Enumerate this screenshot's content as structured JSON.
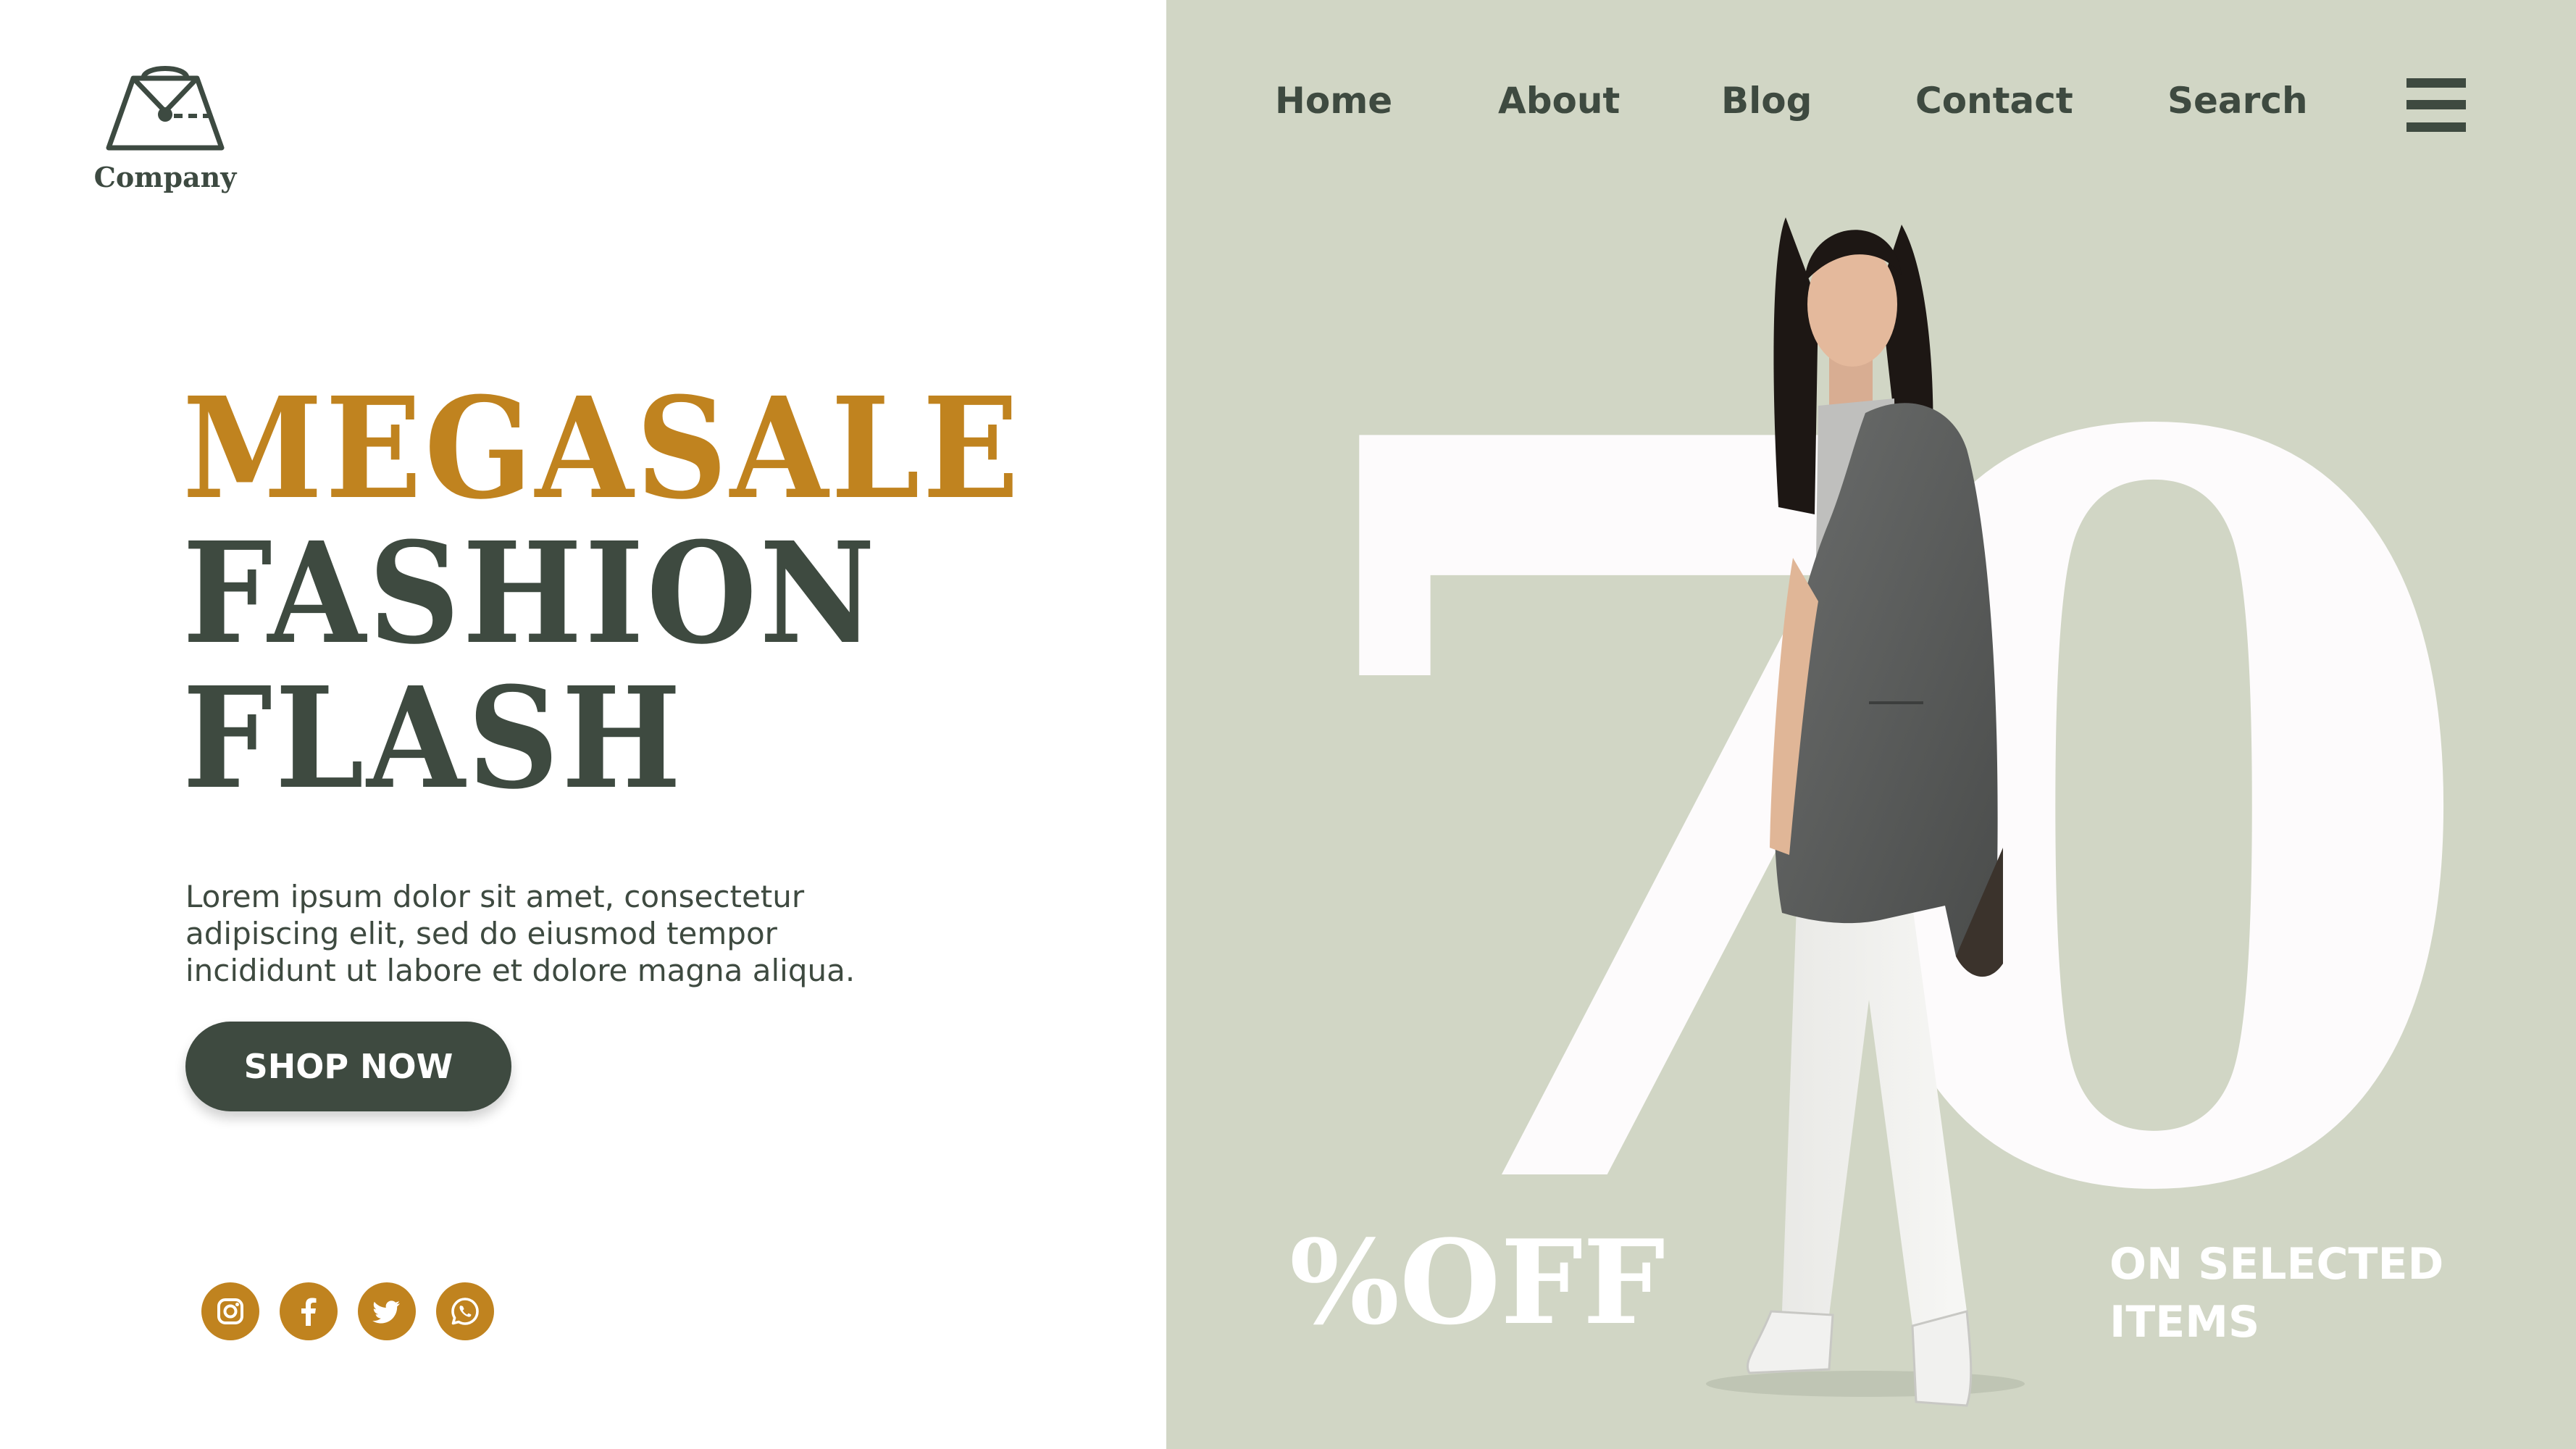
{
  "brand": {
    "logo_icon": "handbag-icon",
    "name": "Company"
  },
  "nav": {
    "items": [
      {
        "label": "Home"
      },
      {
        "label": "About"
      },
      {
        "label": "Blog"
      },
      {
        "label": "Contact"
      },
      {
        "label": "Search"
      }
    ],
    "menu_icon": "hamburger-menu-icon"
  },
  "hero": {
    "headline_line1": "MEGASALE",
    "headline_line2": "FASHION",
    "headline_line3": "FLASH",
    "description": "Lorem ipsum dolor sit amet, consectetur adipiscing elit, sed do eiusmod tempor incididunt ut labore et dolore magna aliqua.",
    "cta_label": "SHOP NOW"
  },
  "promo": {
    "discount_digit1": "7",
    "discount_digit2": "0",
    "off_label": "%OFF",
    "selected_line1": "ON SELECTED",
    "selected_line2": "ITEMS"
  },
  "socials": [
    {
      "icon": "instagram-icon"
    },
    {
      "icon": "facebook-icon"
    },
    {
      "icon": "twitter-icon"
    },
    {
      "icon": "whatsapp-icon"
    }
  ],
  "colors": {
    "accent": "#c0831f",
    "dark": "#3e4a40",
    "panel": "#d1d6c5",
    "white": "#ffffff"
  }
}
